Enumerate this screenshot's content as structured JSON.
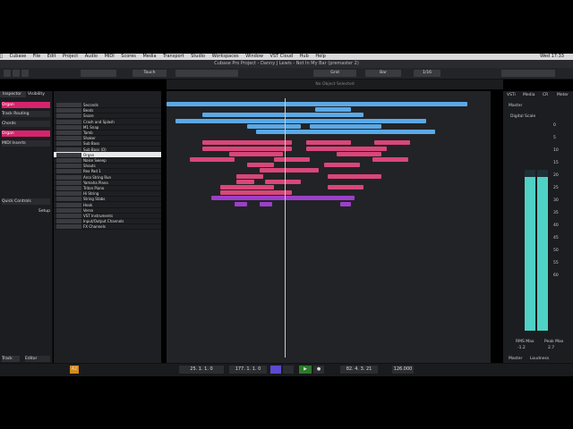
{
  "mac_menu": [
    "Cubase",
    "File",
    "Edit",
    "Project",
    "Audio",
    "MIDI",
    "Scores",
    "Media",
    "Transport",
    "Studio",
    "Workspaces",
    "Window",
    "VST Cloud",
    "Hub",
    "Help"
  ],
  "mac_clock": "Wed 17:33",
  "window_title": "Cubase Pro Project - Danny J Lewis - Not In My Bar (premaster 2)",
  "toolbar": {
    "mode": "Touch",
    "grid": "Grid",
    "bar": "Bar",
    "quantize": "1/16"
  },
  "info_line": "No Object Selected",
  "inspector": {
    "tabs": [
      "Inspector",
      "Visibility"
    ],
    "track_name": "Organ",
    "sections": [
      "Track Routing",
      "Chords",
      "Organ",
      "MIDI Inserts",
      "Quick Controls",
      "Setup"
    ]
  },
  "tracks": [
    "Seconds",
    "Beats",
    "Snare",
    "Crash and Splash",
    "M1 Snap",
    "Tamb",
    "Shaker",
    "Sub Bass",
    "Sub Bass (D)",
    "Organ",
    "Noise Sweep",
    "Shouts",
    "Rex Pad 1",
    "Arco String Run",
    "Yamaha Piano",
    "Triton Piano",
    "Hi String",
    "String Stabs",
    "Hook",
    "Verse",
    "VST Instruments",
    "Input/Output Channels",
    "FX Channels"
  ],
  "ruler_numbers": [
    "1",
    "17",
    "33",
    "49",
    "65",
    "81",
    "97",
    "113",
    "129",
    "145",
    "161",
    "177",
    "193",
    "209"
  ],
  "right_panel": {
    "tabs": [
      "VSTi",
      "Media",
      "CR",
      "Meter"
    ],
    "channel": "Master",
    "digital_scale": "Digital Scale",
    "scale_values": [
      "0",
      "5",
      "10",
      "15",
      "20",
      "25",
      "30",
      "35",
      "40",
      "45",
      "50",
      "55",
      "60"
    ],
    "rms_label": "RMS Max",
    "rms_value": "-1.2",
    "peak_label": "Peak Max",
    "peak_value": "2.7",
    "bottom_tabs": [
      "Master",
      "Loudness"
    ]
  },
  "bottom_tabs": [
    "Track",
    "Editor"
  ],
  "transport": {
    "left_locator": "25. 1. 1. 0",
    "right_locator": "177. 1. 1. 0",
    "position": "82. 4. 3. 21",
    "tempo": "126.000",
    "marker": "A2"
  }
}
